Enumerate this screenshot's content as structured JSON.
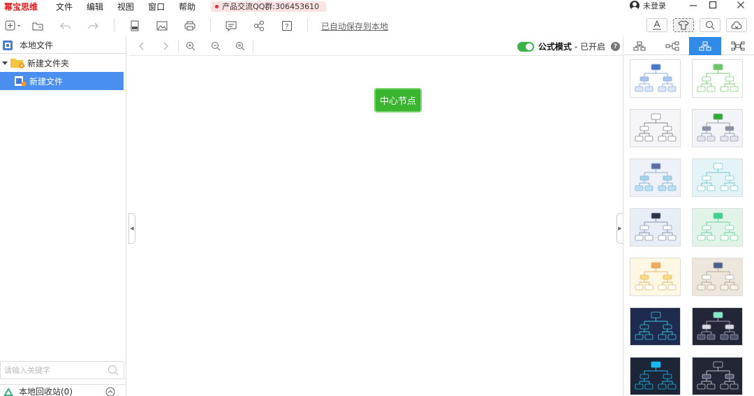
{
  "app": {
    "name": "幂宝思维"
  },
  "menu": [
    "文件",
    "编辑",
    "视图",
    "窗口",
    "帮助"
  ],
  "qq_badge": "产品交流QQ群:306453610",
  "login": "未登录",
  "toolbar": {
    "autosave": "已自动保存到本地"
  },
  "left_panel": {
    "header": "本地文件",
    "folder": "新建文件夹",
    "file": "新建文件",
    "search_placeholder": "请输入关键字",
    "recycle": "本地回收站(0)"
  },
  "canvas": {
    "formula_label": "公式模式",
    "formula_status": "- 已开启",
    "center_node": "中心节点"
  },
  "colors": {
    "accent": "#2f8ae8",
    "node_green": "#3ab52f",
    "brand_red": "#e02020"
  },
  "themes": [
    {
      "bg": "#ffffff",
      "root": "#4a78c6",
      "child": "#a9c6ee",
      "leaf": "#dbe7f8",
      "line": "#8fb0dd"
    },
    {
      "bg": "#ffffff",
      "root": "#6cc46a",
      "child": "#ffffff",
      "leaf": "#ffffff",
      "line": "#7ccb7a"
    },
    {
      "bg": "#f5f5f8",
      "root": "#ffffff",
      "child": "#ffffff",
      "leaf": "#ffffff",
      "line": "#888888"
    },
    {
      "bg": "#f3f4f8",
      "root": "#2cae2c",
      "child": "#8a93a6",
      "leaf": "#e3e6ee",
      "line": "#9aa0ae"
    },
    {
      "bg": "#eef2f8",
      "root": "#5e6ea4",
      "child": "#a5d4ee",
      "leaf": "#b8e2f4",
      "line": "#8ab2d6"
    },
    {
      "bg": "#e4f4f6",
      "root": "#ffffff",
      "child": "#ffffff",
      "leaf": "#ffffff",
      "line": "#7cc6cf"
    },
    {
      "bg": "#e8eef6",
      "root": "#2c3344",
      "child": "#ffffff",
      "leaf": "#ffffff",
      "line": "#8a97ad"
    },
    {
      "bg": "#e2f4ea",
      "root": "#3fcf8a",
      "child": "#ffffff",
      "leaf": "#ffffff",
      "line": "#6fd29f"
    },
    {
      "bg": "#fdf7e4",
      "root": "#f0a860",
      "child": "#f7dc82",
      "leaf": "#ffffff",
      "line": "#e5b870"
    },
    {
      "bg": "#ece6dc",
      "root": "#4a5f92",
      "child": "#ffffff",
      "leaf": "#f6f2ea",
      "line": "#b0a898"
    },
    {
      "bg": "#1e2a4e",
      "root": "#1e2a4e",
      "child": "#1e2a4e",
      "leaf": "#1e2a4e",
      "line": "#3cc7e0"
    },
    {
      "bg": "#222637",
      "root": "#7ef0c8",
      "child": "#d8d8e0",
      "leaf": "#4a5068",
      "line": "#9aa0b6"
    },
    {
      "bg": "#1d2638",
      "root": "#18b8f0",
      "child": "#1d2638",
      "leaf": "#1d2638",
      "line": "#18b8f0"
    },
    {
      "bg": "#232635",
      "root": "#232635",
      "child": "#555b70",
      "leaf": "#232635",
      "line": "#c0c4d0"
    }
  ]
}
